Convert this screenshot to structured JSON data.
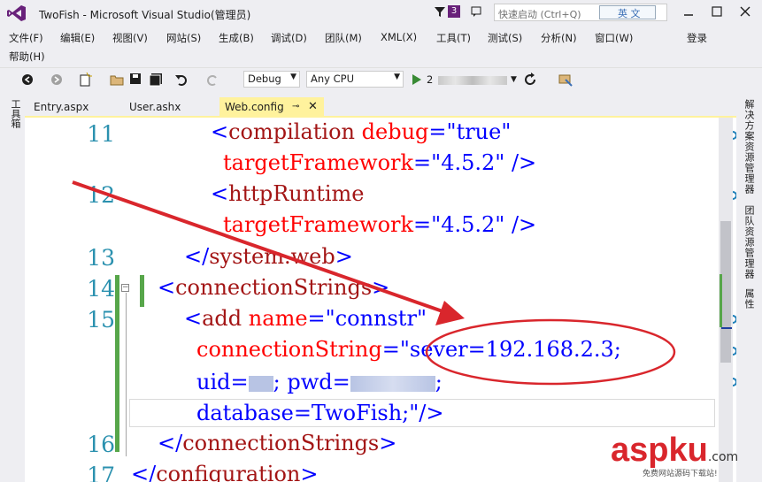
{
  "window": {
    "title": "TwoFish - Microsoft Visual Studio(管理员)",
    "notification_count": "3",
    "quick_launch_placeholder": "快速启动 (Ctrl+Q)",
    "ime_label": "英 文"
  },
  "menu": {
    "row1": [
      "文件(F)",
      "编辑(E)",
      "视图(V)",
      "网站(S)",
      "生成(B)",
      "调试(D)",
      "团队(M)",
      "XML(X)",
      "工具(T)",
      "测试(S)",
      "分析(N)",
      "窗口(W)"
    ],
    "signin": "登录",
    "row2": [
      "帮助(H)"
    ]
  },
  "toolbar": {
    "config": "Debug",
    "platform": "Any CPU",
    "run_target": "2"
  },
  "side_panels": {
    "left": "工具箱",
    "right": [
      "解决方案资源管理器",
      "团队资源管理器",
      "属性"
    ]
  },
  "tabs": [
    {
      "label": "Entry.aspx",
      "active": false
    },
    {
      "label": "User.ashx",
      "active": false
    },
    {
      "label": "Web.config",
      "active": true
    }
  ],
  "editor": {
    "line_numbers": [
      "11",
      "12",
      "13",
      "14",
      "15",
      "16",
      "17"
    ],
    "lines": [
      {
        "parts": [
          "<",
          "compilation",
          " ",
          "debug",
          "=\"",
          "true",
          "\""
        ]
      },
      {
        "parts": [
          "targetFramework",
          "=\"",
          "4.5.2",
          "\" />"
        ]
      },
      {
        "parts": [
          "<",
          "httpRuntime"
        ]
      },
      {
        "parts": [
          "targetFramework",
          "=\"",
          "4.5.2",
          "\" />"
        ]
      },
      {
        "parts": [
          "</",
          "system.web",
          ">"
        ]
      },
      {
        "parts": [
          "<",
          "connectionStrings",
          ">"
        ]
      },
      {
        "parts": [
          "<",
          "add",
          " ",
          "name",
          "=\"",
          "connstr",
          "\""
        ]
      },
      {
        "parts": [
          "connectionString",
          "=\"",
          "sever=192.168.2.3;"
        ]
      },
      {
        "parts": [
          "uid=",
          "; pwd=",
          ";"
        ]
      },
      {
        "parts": [
          "database=TwoFish;",
          "\"/>"
        ]
      },
      {
        "parts": [
          "</",
          "connectionStrings",
          ">"
        ]
      },
      {
        "parts": [
          "</",
          "configuration",
          ">"
        ]
      }
    ]
  },
  "watermark": {
    "main": "aspku",
    "suffix": ".com",
    "sub": "免费网站源码下载站!"
  },
  "colors": {
    "annotation": "#d9262c",
    "active_tab": "#fff29d",
    "line_number": "#2b91af"
  }
}
